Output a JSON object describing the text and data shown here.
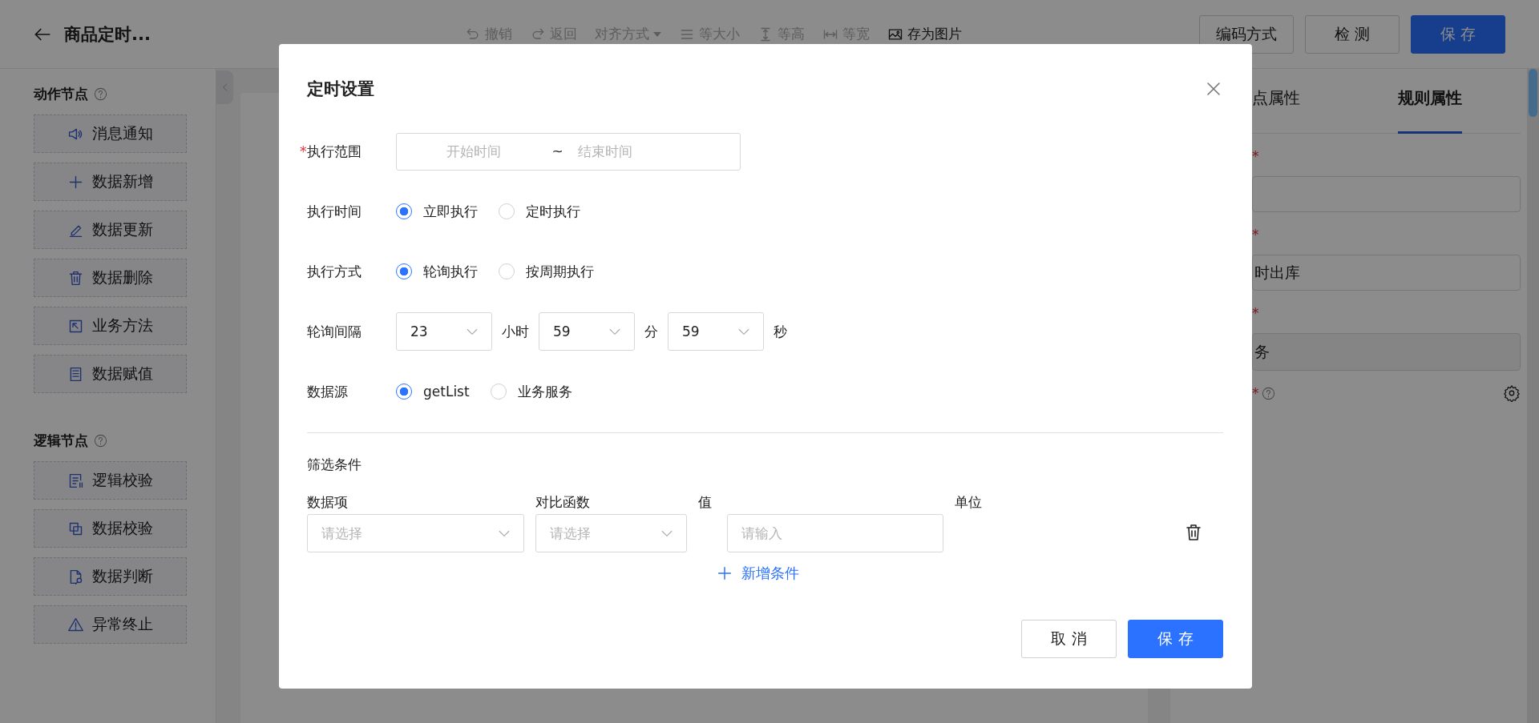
{
  "header": {
    "title": "商品定时...",
    "toolbar": [
      {
        "label": "撤销",
        "disabled": true
      },
      {
        "label": "返回",
        "disabled": true
      },
      {
        "label": "对齐方式",
        "disabled": true
      },
      {
        "label": "等大小",
        "disabled": true
      },
      {
        "label": "等高",
        "disabled": true
      },
      {
        "label": "等宽",
        "disabled": true
      },
      {
        "label": "存为图片",
        "disabled": false
      }
    ],
    "buttons": [
      {
        "label": "编码方式",
        "kind": "default"
      },
      {
        "label": "检 测",
        "kind": "default"
      },
      {
        "label": "保 存",
        "kind": "primary"
      }
    ]
  },
  "sidebar": {
    "groups": [
      {
        "title": "动作节点",
        "items": [
          {
            "label": "消息通知"
          },
          {
            "label": "数据新增"
          },
          {
            "label": "数据更新"
          },
          {
            "label": "数据删除"
          },
          {
            "label": "业务方法"
          },
          {
            "label": "数据赋值"
          }
        ]
      },
      {
        "title": "逻辑节点",
        "items": [
          {
            "label": "逻辑校验"
          },
          {
            "label": "数据校验"
          },
          {
            "label": "数据判断"
          },
          {
            "label": "异常终止"
          }
        ]
      }
    ]
  },
  "right_panel": {
    "tabs": [
      {
        "label": "点属性",
        "selected": false
      },
      {
        "label": "规则属性",
        "selected": true
      }
    ],
    "fields": [
      {
        "kind": "input",
        "required_mark": "*"
      },
      {
        "kind": "input",
        "required_mark": "*",
        "value": "时出库"
      },
      {
        "kind": "disabled",
        "required_mark": "*",
        "value": "务"
      },
      {
        "kind": "help",
        "required_mark": "*"
      }
    ]
  },
  "dialog": {
    "title": "定时设置",
    "rows": [
      {
        "kind": "range",
        "label": "执行范围",
        "required_mark": "*",
        "start_placeholder": "开始时间",
        "separator": "~",
        "end_placeholder": "结束时间"
      },
      {
        "kind": "radio",
        "label": "执行时间",
        "options": [
          {
            "label": "立即执行",
            "selected": true
          },
          {
            "label": "定时执行",
            "selected": false
          }
        ]
      },
      {
        "kind": "radio",
        "label": "执行方式",
        "options": [
          {
            "label": "轮询执行",
            "selected": true
          },
          {
            "label": "按周期执行",
            "selected": false
          }
        ]
      },
      {
        "kind": "interval",
        "label": "轮询间隔",
        "parts": [
          {
            "value": "23",
            "unit": "小时"
          },
          {
            "value": "59",
            "unit": "分"
          },
          {
            "value": "59",
            "unit": "秒"
          }
        ]
      },
      {
        "kind": "radio",
        "label": "数据源",
        "options": [
          {
            "label": "getList",
            "selected": true
          },
          {
            "label": "业务服务",
            "selected": false
          }
        ]
      }
    ],
    "filter": {
      "title": "筛选条件",
      "columns": [
        "数据项",
        "对比函数",
        "值",
        "单位"
      ],
      "cells": [
        {
          "kind": "select",
          "placeholder": "请选择"
        },
        {
          "kind": "select",
          "placeholder": "请选择"
        },
        {
          "kind": "input",
          "placeholder": "请输入"
        }
      ],
      "add_label": "新增条件"
    },
    "buttons": [
      {
        "label": "取 消",
        "kind": "default"
      },
      {
        "label": "保 存",
        "kind": "primary"
      }
    ]
  }
}
